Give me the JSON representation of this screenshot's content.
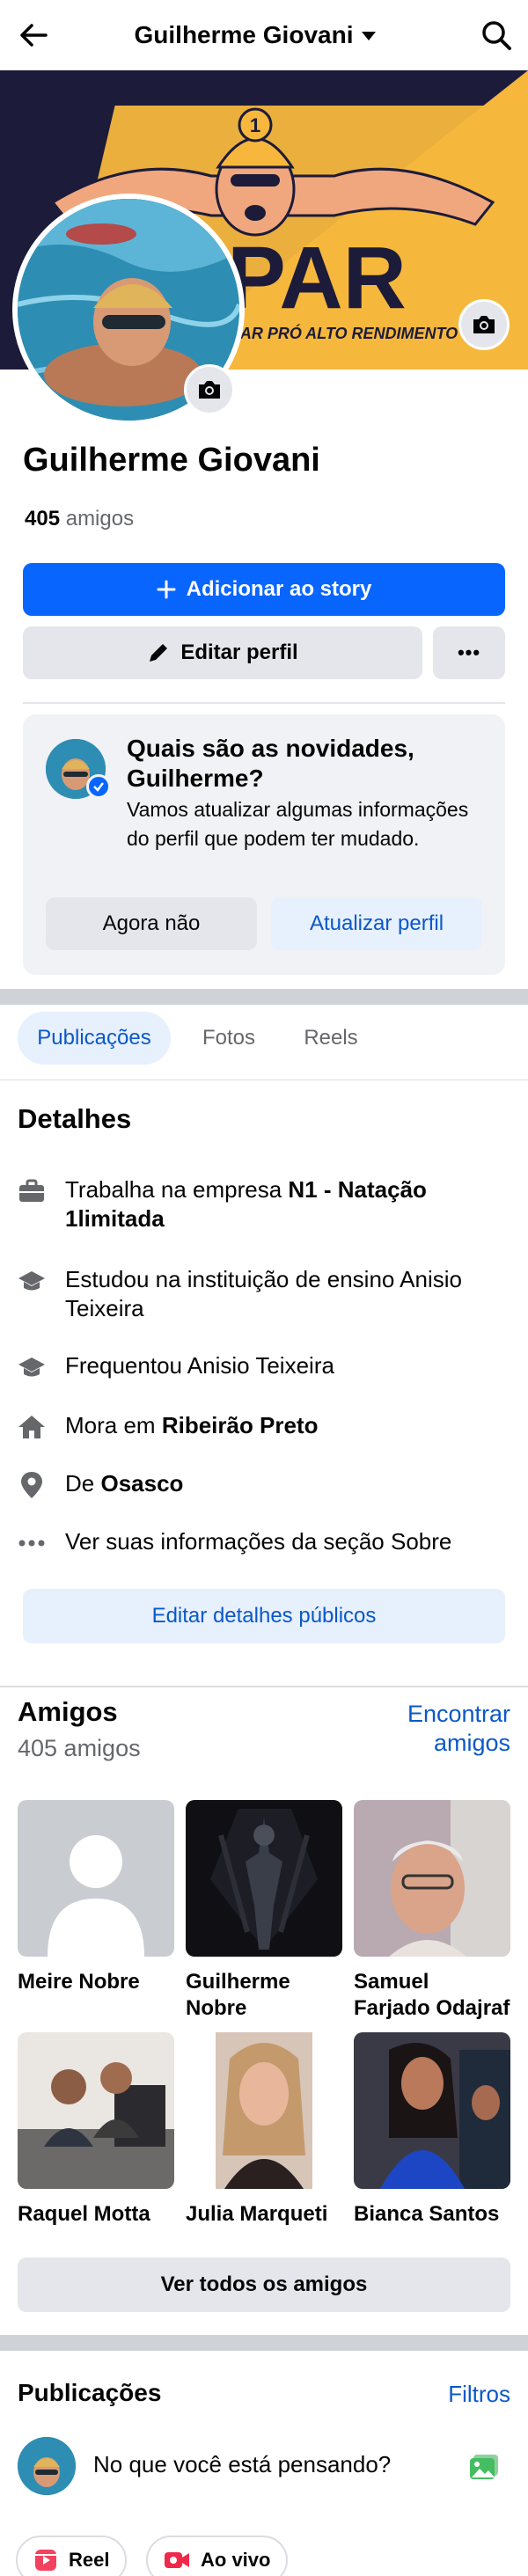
{
  "header": {
    "title": "Guilherme Giovani"
  },
  "cover": {
    "brand_text": "PAR",
    "tagline": "NAR PRÓ ALTO RENDIMENTO",
    "badge_number": "1"
  },
  "profile": {
    "name": "Guilherme Giovani",
    "friends_number": "405",
    "friends_word": "amigos"
  },
  "actions": {
    "add_story": "Adicionar ao story",
    "edit_profile": "Editar perfil",
    "more": "•••"
  },
  "prompt_card": {
    "title": "Quais são as novidades, Guilherme?",
    "description": "Vamos atualizar algumas informações do perfil que podem ter mudado.",
    "dismiss": "Agora não",
    "update": "Atualizar perfil"
  },
  "tabs": [
    {
      "label": "Publicações",
      "active": true
    },
    {
      "label": "Fotos",
      "active": false
    },
    {
      "label": "Reels",
      "active": false
    }
  ],
  "details": {
    "title": "Detalhes",
    "work_prefix": "Trabalha na empresa ",
    "work_bold": "N1 - Natação 1limitada",
    "studied": "Estudou na instituição de ensino Anisio Teixeira",
    "attended": "Frequentou Anisio Teixeira",
    "lives_prefix": "Mora em ",
    "lives_bold": "Ribeirão Preto",
    "from_prefix": "De ",
    "from_bold": "Osasco",
    "about": "Ver suas informações da seção Sobre",
    "edit_button": "Editar detalhes públicos"
  },
  "friends": {
    "title": "Amigos",
    "count": "405 amigos",
    "find": "Encontrar amigos",
    "list": [
      {
        "name": "Meire Nobre"
      },
      {
        "name": "Guilherme Nobre"
      },
      {
        "name": "Samuel Farjado Odajraf"
      },
      {
        "name": "Raquel Motta"
      },
      {
        "name": "Julia Marqueti"
      },
      {
        "name": "Bianca Santos"
      }
    ],
    "see_all": "Ver todos os amigos"
  },
  "posts": {
    "title": "Publicações",
    "filters": "Filtros",
    "composer_placeholder": "No que você está pensando?",
    "chips": [
      {
        "label": "Reel"
      },
      {
        "label": "Ao vivo"
      }
    ]
  },
  "colors": {
    "primary": "#0866ff",
    "link": "#0a58ca",
    "secondary_bg": "#e4e6eb",
    "cover_yellow": "#f6b73c",
    "cover_navy": "#1c1b3a"
  }
}
